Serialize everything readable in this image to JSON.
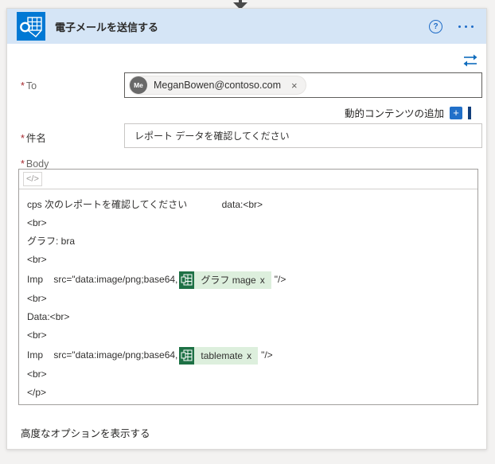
{
  "header": {
    "title": "電子メールを送信する"
  },
  "icons": {
    "help": "?",
    "code": "</>",
    "close": "×"
  },
  "colors": {
    "header_bg": "#d5e5f6",
    "outlook_blue": "#0078d4",
    "accent_blue": "#2170c9",
    "icon_blue": "#1f6cc7",
    "excel_green": "#1e7145",
    "token_bg": "#ddefdd",
    "required_red": "#a4262c"
  },
  "fields": {
    "to": {
      "required": "*",
      "label": "To",
      "recipient": {
        "initials": "Me",
        "email": "MeganBowen@contoso.com"
      }
    },
    "dynamic_content": {
      "label": "動的コンテンツの追加",
      "plus_glyph": "+"
    },
    "subject": {
      "required": "*",
      "label": "件名",
      "value": "レポート データを確認してください"
    },
    "body": {
      "required": "*",
      "label": "Body",
      "lines": [
        {
          "type": "text",
          "text": "cps 次のレポートを確認してください             data:<br>"
        },
        {
          "type": "text",
          "text": "<br>"
        },
        {
          "type": "text",
          "text": "グラフ: bra"
        },
        {
          "type": "text",
          "text": "<br>"
        },
        {
          "type": "token",
          "prefix": "Imp    src=\"data:image/png;base64,",
          "token_label": "グラフ mage",
          "token_close": "x",
          "suffix": "\"/>"
        },
        {
          "type": "text",
          "text": "<br>"
        },
        {
          "type": "text",
          "text": "Data:<br>"
        },
        {
          "type": "text",
          "text": "<br>"
        },
        {
          "type": "token",
          "prefix": "Imp    src=\"data:image/png;base64,",
          "token_label": "tablemate",
          "token_close": "x",
          "suffix": "\"/>"
        },
        {
          "type": "text",
          "text": "<br>"
        },
        {
          "type": "text",
          "text": "</p>"
        }
      ]
    }
  },
  "footer": {
    "advanced_options_label": "高度なオプションを表示する"
  }
}
